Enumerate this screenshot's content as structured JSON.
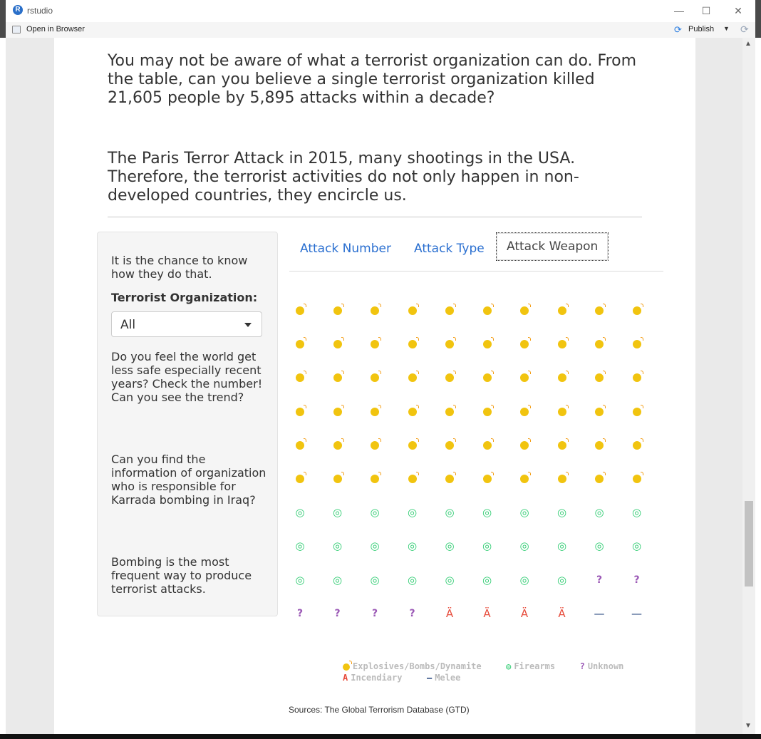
{
  "window": {
    "title": "rstudio",
    "logo": "R"
  },
  "toolbar": {
    "open_in_browser": "Open in Browser",
    "publish": "Publish"
  },
  "content": {
    "para1": "You may not be aware of what a terrorist organization can do. From the table, can you believe a single terrorist organization killed 21,605 people by 5,895 attacks within a decade?",
    "para2": "The Paris Terror Attack in 2015, many shootings in the USA. Therefore, the terrorist activities do not only happen in non-developed countries, they encircle us."
  },
  "sidebar": {
    "intro": "It is the chance to know how they do that.",
    "label": "Terrorist Organization:",
    "select_value": "All",
    "q1": "Do you feel the world get less safe especially recent years? Check the number! Can you see the trend?",
    "q2": "Can you find the information of organization who is responsible for Karrada bombing in Iraq?",
    "q3": "Bombing is the most frequent way to produce terrorist attacks."
  },
  "tabs": [
    {
      "label": "Attack Number",
      "active": false
    },
    {
      "label": "Attack Type",
      "active": false
    },
    {
      "label": "Attack Weapon",
      "active": true
    }
  ],
  "chart_data": {
    "type": "waffle",
    "rows": 10,
    "cols": 10,
    "series": [
      {
        "name": "Explosives/Bombs/Dynamite",
        "count": 60,
        "color": "#f1c40f",
        "icon": "bomb-icon"
      },
      {
        "name": "Firearms",
        "count": 28,
        "color": "#2ecc71",
        "icon": "bullseye-icon"
      },
      {
        "name": "Unknown",
        "count": 6,
        "color": "#9b59b6",
        "icon": "question-icon"
      },
      {
        "name": "Incendiary",
        "count": 4,
        "color": "#e74c3c",
        "icon": "incendiary-icon"
      },
      {
        "name": "Melee",
        "count": 2,
        "color": "#1e3f7a",
        "icon": "dash-icon"
      }
    ],
    "glyphs": {
      "firearms": "◎",
      "unknown": "?",
      "incendiary": "Ä",
      "melee": "—",
      "legend_incendiary": "A"
    }
  },
  "source": "Sources: The Global Terrorism Database (GTD)"
}
